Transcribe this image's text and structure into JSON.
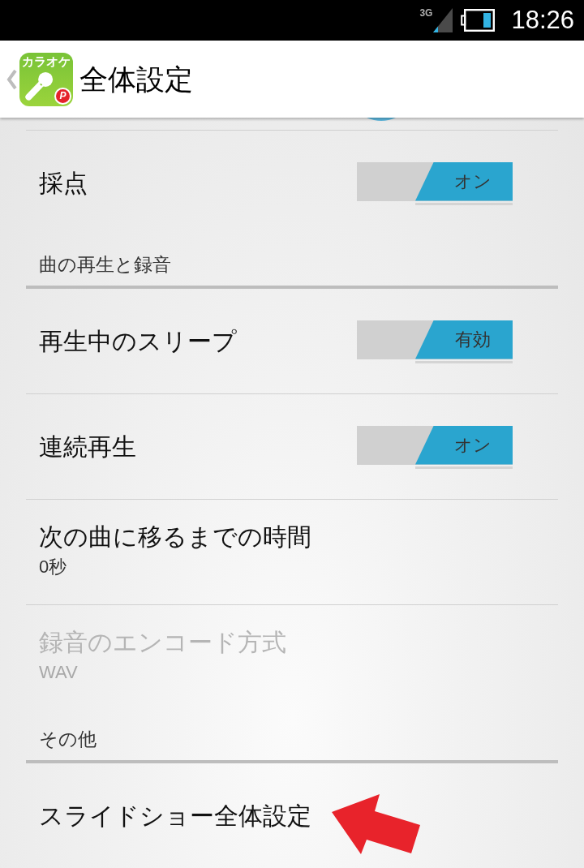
{
  "status_bar": {
    "network_type": "3G",
    "time": "18:26"
  },
  "action_bar": {
    "app_icon": {
      "label": "カラオケ",
      "badge": "P"
    },
    "title": "全体設定"
  },
  "settings": [
    {
      "kind": "switch",
      "title": "採点",
      "switch_label": "オン",
      "on": true
    },
    {
      "kind": "category",
      "title": "曲の再生と録音"
    },
    {
      "kind": "switch",
      "title": "再生中のスリープ",
      "switch_label": "有効",
      "on": true
    },
    {
      "kind": "switch",
      "title": "連続再生",
      "switch_label": "オン",
      "on": true
    },
    {
      "kind": "value",
      "title": "次の曲に移るまでの時間",
      "summary": "0秒",
      "disabled": false
    },
    {
      "kind": "value",
      "title": "録音のエンコード方式",
      "summary": "WAV",
      "disabled": true
    },
    {
      "kind": "category",
      "title": "その他"
    },
    {
      "kind": "plain",
      "title": "スライドショー全体設定"
    }
  ]
}
